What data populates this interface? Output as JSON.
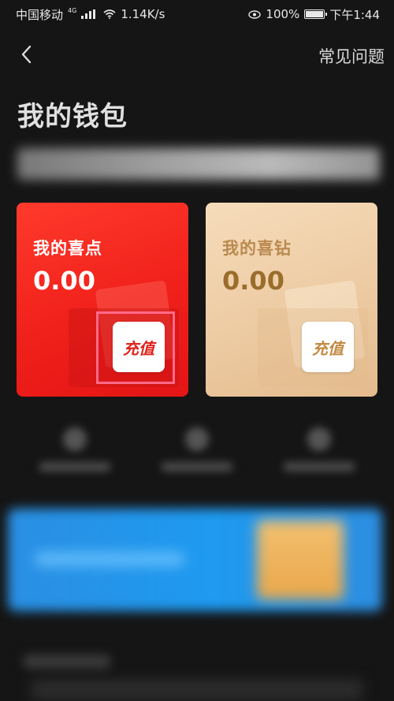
{
  "status_bar": {
    "carrier": "中国移动",
    "network": "4G",
    "speed": "1.14K/s",
    "battery": "100%",
    "time": "下午1:44"
  },
  "nav": {
    "back_icon": "chevron-left-icon",
    "faq_label": "常见问题"
  },
  "page": {
    "title": "我的钱包"
  },
  "wallet": {
    "points": {
      "label": "我的喜点",
      "amount": "0.00",
      "recharge_label": "充值",
      "color": "#f0201a"
    },
    "diamonds": {
      "label": "我的喜钻",
      "amount": "0.00",
      "recharge_label": "充值",
      "color": "#ecc9a0"
    }
  },
  "colors": {
    "background": "#151515",
    "highlight": "#ff6a8a",
    "banner_blue": "#1e9af0"
  }
}
